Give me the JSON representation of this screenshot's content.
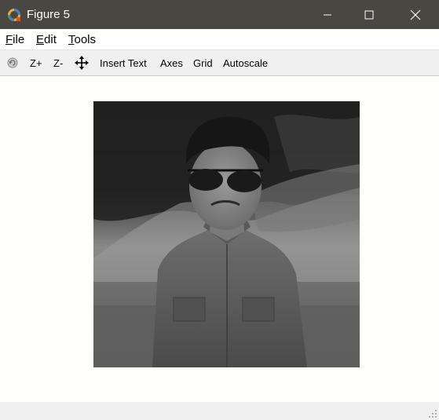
{
  "window": {
    "title": "Figure 5",
    "icons": {
      "app": "octave-logo-icon",
      "minimize": "minimize-icon",
      "maximize": "maximize-icon",
      "close": "close-icon"
    }
  },
  "menu": {
    "file_first": "F",
    "file_rest": "ile",
    "edit_first": "E",
    "edit_rest": "dit",
    "tools_first": "T",
    "tools_rest": "ools"
  },
  "toolbar": {
    "rotate_icon": "rotate-icon",
    "zoom_in": "Z+",
    "zoom_out": "Z-",
    "pan_icon": "pan-icon",
    "insert_text": "Insert Text",
    "axes": "Axes",
    "grid": "Grid",
    "autoscale": "Autoscale"
  },
  "figure": {
    "image_subject": "grayscale photo",
    "colors": {
      "canvas": "#fefefa",
      "titlebar": "#4a4642"
    }
  }
}
